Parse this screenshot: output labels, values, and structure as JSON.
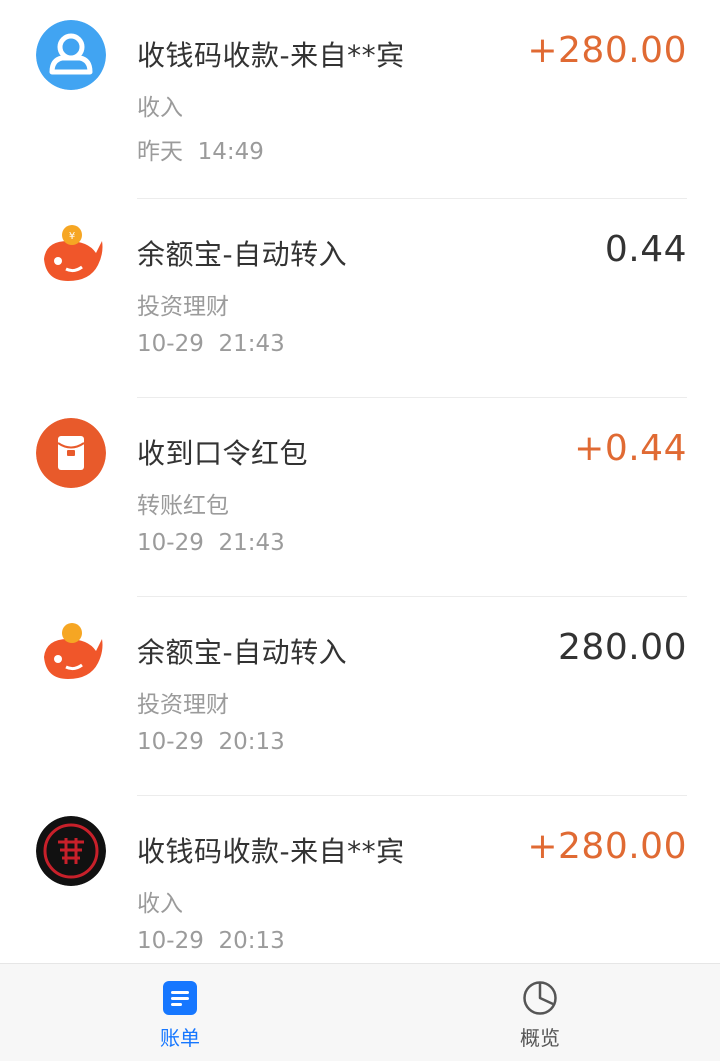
{
  "colors": {
    "income": "#e06a33",
    "neutral": "#333333",
    "secondary": "#9b9b9b",
    "accent": "#1677ff"
  },
  "transactions": [
    {
      "avatar": "user-avatar-icon",
      "title": "收钱码收款-来自**宾",
      "category": "收入",
      "time": "昨天  14:49",
      "amount": "+280.00",
      "amount_type": "income"
    },
    {
      "avatar": "yuebao-fish-icon",
      "title": "余额宝-自动转入",
      "category": "投资理财",
      "time": "10-29  21:43",
      "amount": "0.44",
      "amount_type": "neutral"
    },
    {
      "avatar": "red-envelope-icon",
      "title": "收到口令红包",
      "category": "转账红包",
      "time": "10-29  21:43",
      "amount": "+0.44",
      "amount_type": "income"
    },
    {
      "avatar": "yuebao-fish-icon",
      "title": "余额宝-自动转入",
      "category": "投资理财",
      "time": "10-29  20:13",
      "amount": "280.00",
      "amount_type": "neutral"
    },
    {
      "avatar": "seal-logo-avatar",
      "title": "收钱码收款-来自**宾",
      "category": "收入",
      "time": "10-29  20:13",
      "amount": "+280.00",
      "amount_type": "income"
    }
  ],
  "tabbar": {
    "bill_label": "账单",
    "overview_label": "概览",
    "active_tab": "bill"
  }
}
